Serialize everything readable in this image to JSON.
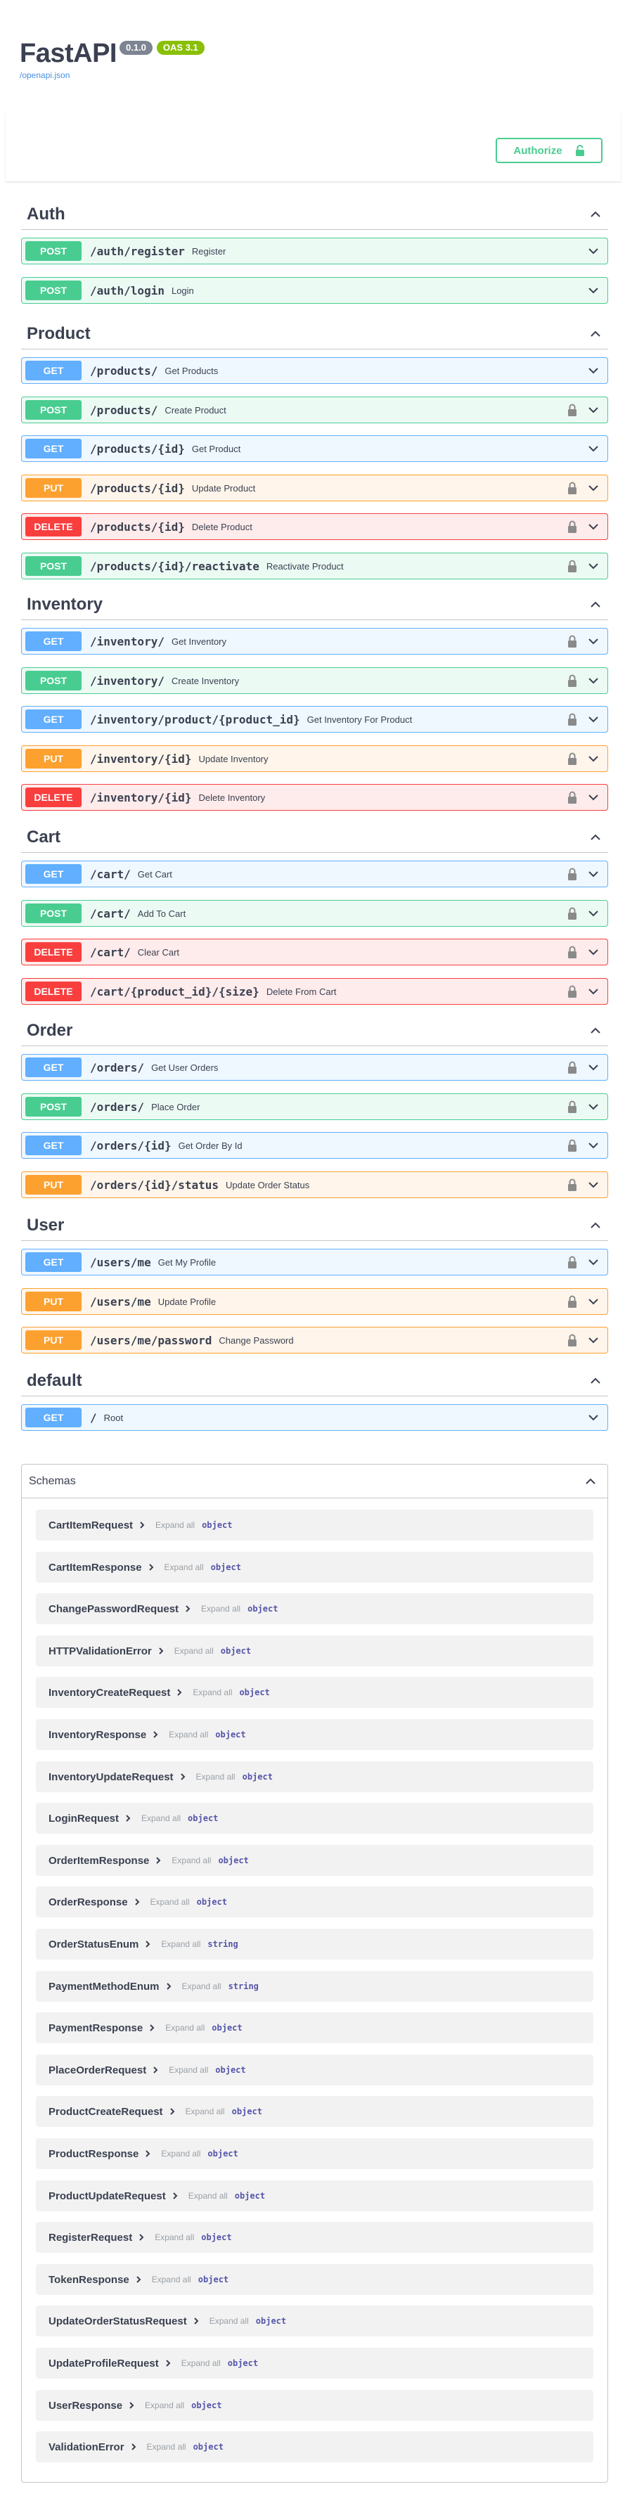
{
  "info": {
    "title": "FastAPI",
    "version": "0.1.0",
    "oas": "OAS 3.1",
    "openapi_link": "/openapi.json"
  },
  "authorize": {
    "label": "Authorize"
  },
  "colors": {
    "get": "#61affe",
    "post": "#49cc90",
    "put": "#fca130",
    "delete": "#f93e3e"
  },
  "tags": [
    {
      "name": "Auth",
      "ops": [
        {
          "method": "POST",
          "path": "/auth/register",
          "summary": "Register",
          "locked": false
        },
        {
          "method": "POST",
          "path": "/auth/login",
          "summary": "Login",
          "locked": false
        }
      ]
    },
    {
      "name": "Product",
      "ops": [
        {
          "method": "GET",
          "path": "/products/",
          "summary": "Get Products",
          "locked": false
        },
        {
          "method": "POST",
          "path": "/products/",
          "summary": "Create Product",
          "locked": true
        },
        {
          "method": "GET",
          "path": "/products/{id}",
          "summary": "Get Product",
          "locked": false
        },
        {
          "method": "PUT",
          "path": "/products/{id}",
          "summary": "Update Product",
          "locked": true
        },
        {
          "method": "DELETE",
          "path": "/products/{id}",
          "summary": "Delete Product",
          "locked": true
        },
        {
          "method": "POST",
          "path": "/products/{id}/reactivate",
          "summary": "Reactivate Product",
          "locked": true
        }
      ]
    },
    {
      "name": "Inventory",
      "ops": [
        {
          "method": "GET",
          "path": "/inventory/",
          "summary": "Get Inventory",
          "locked": true
        },
        {
          "method": "POST",
          "path": "/inventory/",
          "summary": "Create Inventory",
          "locked": true
        },
        {
          "method": "GET",
          "path": "/inventory/product/{product_id}",
          "summary": "Get Inventory For Product",
          "locked": true
        },
        {
          "method": "PUT",
          "path": "/inventory/{id}",
          "summary": "Update Inventory",
          "locked": true
        },
        {
          "method": "DELETE",
          "path": "/inventory/{id}",
          "summary": "Delete Inventory",
          "locked": true
        }
      ]
    },
    {
      "name": "Cart",
      "ops": [
        {
          "method": "GET",
          "path": "/cart/",
          "summary": "Get Cart",
          "locked": true
        },
        {
          "method": "POST",
          "path": "/cart/",
          "summary": "Add To Cart",
          "locked": true
        },
        {
          "method": "DELETE",
          "path": "/cart/",
          "summary": "Clear Cart",
          "locked": true
        },
        {
          "method": "DELETE",
          "path": "/cart/{product_id}/{size}",
          "summary": "Delete From Cart",
          "locked": true
        }
      ]
    },
    {
      "name": "Order",
      "ops": [
        {
          "method": "GET",
          "path": "/orders/",
          "summary": "Get User Orders",
          "locked": true
        },
        {
          "method": "POST",
          "path": "/orders/",
          "summary": "Place Order",
          "locked": true
        },
        {
          "method": "GET",
          "path": "/orders/{id}",
          "summary": "Get Order By Id",
          "locked": true
        },
        {
          "method": "PUT",
          "path": "/orders/{id}/status",
          "summary": "Update Order Status",
          "locked": true
        }
      ]
    },
    {
      "name": "User",
      "ops": [
        {
          "method": "GET",
          "path": "/users/me",
          "summary": "Get My Profile",
          "locked": true
        },
        {
          "method": "PUT",
          "path": "/users/me",
          "summary": "Update Profile",
          "locked": true
        },
        {
          "method": "PUT",
          "path": "/users/me/password",
          "summary": "Change Password",
          "locked": true
        }
      ]
    },
    {
      "name": "default",
      "ops": [
        {
          "method": "GET",
          "path": "/",
          "summary": "Root",
          "locked": false
        }
      ]
    }
  ],
  "schemas": {
    "title": "Schemas",
    "expand_label": "Expand all",
    "items": [
      {
        "name": "CartItemRequest",
        "type": "object"
      },
      {
        "name": "CartItemResponse",
        "type": "object"
      },
      {
        "name": "ChangePasswordRequest",
        "type": "object"
      },
      {
        "name": "HTTPValidationError",
        "type": "object"
      },
      {
        "name": "InventoryCreateRequest",
        "type": "object"
      },
      {
        "name": "InventoryResponse",
        "type": "object"
      },
      {
        "name": "InventoryUpdateRequest",
        "type": "object"
      },
      {
        "name": "LoginRequest",
        "type": "object"
      },
      {
        "name": "OrderItemResponse",
        "type": "object"
      },
      {
        "name": "OrderResponse",
        "type": "object"
      },
      {
        "name": "OrderStatusEnum",
        "type": "string"
      },
      {
        "name": "PaymentMethodEnum",
        "type": "string"
      },
      {
        "name": "PaymentResponse",
        "type": "object"
      },
      {
        "name": "PlaceOrderRequest",
        "type": "object"
      },
      {
        "name": "ProductCreateRequest",
        "type": "object"
      },
      {
        "name": "ProductResponse",
        "type": "object"
      },
      {
        "name": "ProductUpdateRequest",
        "type": "object"
      },
      {
        "name": "RegisterRequest",
        "type": "object"
      },
      {
        "name": "TokenResponse",
        "type": "object"
      },
      {
        "name": "UpdateOrderStatusRequest",
        "type": "object"
      },
      {
        "name": "UpdateProfileRequest",
        "type": "object"
      },
      {
        "name": "UserResponse",
        "type": "object"
      },
      {
        "name": "ValidationError",
        "type": "object"
      }
    ]
  }
}
